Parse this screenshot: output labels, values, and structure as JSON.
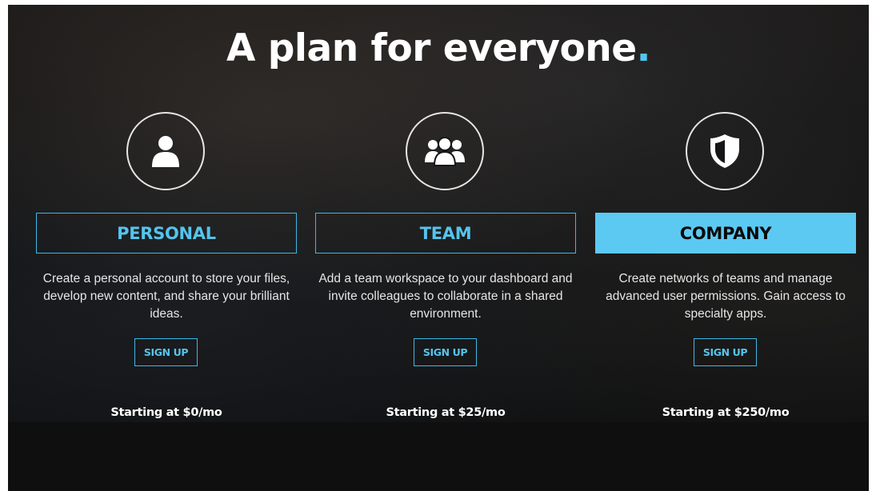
{
  "headline": {
    "text": "A plan for everyone",
    "dot": "."
  },
  "colors": {
    "accent": "#5cc9f2",
    "background": "#0d0d0d",
    "text": "#ffffff"
  },
  "plans": [
    {
      "icon": "user-icon",
      "title": "PERSONAL",
      "description": "Create a personal account to store your files, develop new content, and share your brilliant ideas.",
      "cta": "SIGN UP",
      "price": "Starting at $0/mo",
      "highlighted": false
    },
    {
      "icon": "team-icon",
      "title": "TEAM",
      "description": "Add a team workspace to your dashboard and invite colleagues to collaborate in a shared environment.",
      "cta": "SIGN UP",
      "price": "Starting at $25/mo",
      "highlighted": false
    },
    {
      "icon": "shield-icon",
      "title": "COMPANY",
      "description": "Create networks of teams and manage advanced user permissions. Gain access to specialty apps.",
      "cta": "SIGN UP",
      "price": "Starting at $250/mo",
      "highlighted": true
    }
  ]
}
